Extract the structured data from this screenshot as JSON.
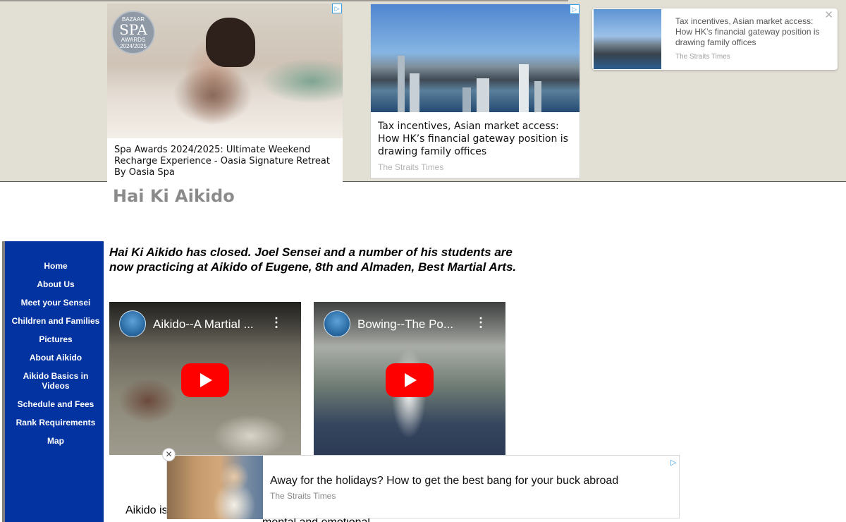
{
  "ads": {
    "card1": {
      "caption": "Spa Awards 2024/2025: Ultimate Weekend Recharge Experience - Oasia Signature Retreat By Oasia Spa",
      "badge_top": "BAZAAR",
      "badge_mid": "SPA",
      "badge_bot": "AWARDS",
      "badge_year": "2024/2025"
    },
    "card2": {
      "caption": "Tax incentives, Asian market access: How HK’s financial gateway position is drawing family offices",
      "source": "The Straits Times"
    },
    "card3": {
      "caption": "Tax incentives, Asian market access: How HK’s financial gateway position is drawing family offices",
      "source": "The Straits Times",
      "close": "✕"
    },
    "adchoices_icon": "▷",
    "anchor": {
      "caption": "Away for the holidays? How to get the best bang for your buck abroad",
      "source": "The Straits Times",
      "close": "✕",
      "adchoices": "▷"
    }
  },
  "site": {
    "title": "Hai Ki Aikido",
    "nav": [
      "Home",
      "About Us",
      "Meet your Sensei",
      "Children and Families",
      "Pictures",
      "About Aikido",
      "Aikido Basics in Videos",
      "Schedule and Fees",
      "Rank Requirements",
      "Map"
    ],
    "notice": "Hai Ki Aikido has closed. Joel Sensei and a number of his students are now practicing at Aikido of Eugene, 8th and Almaden, Best Martial Arts.",
    "videos": [
      {
        "title": "Aikido--A Martial ...",
        "menu": "⋮"
      },
      {
        "title": "Bowing--The Po...",
        "menu": "⋮"
      }
    ],
    "body_text_start": "Aikido is",
    "body_text_cont": "mental and emotional"
  },
  "colors": {
    "sidebar": "#0233a0",
    "title": "#8b8b8b",
    "ad_band": "#e2dfd5",
    "play": "#ff0000"
  }
}
